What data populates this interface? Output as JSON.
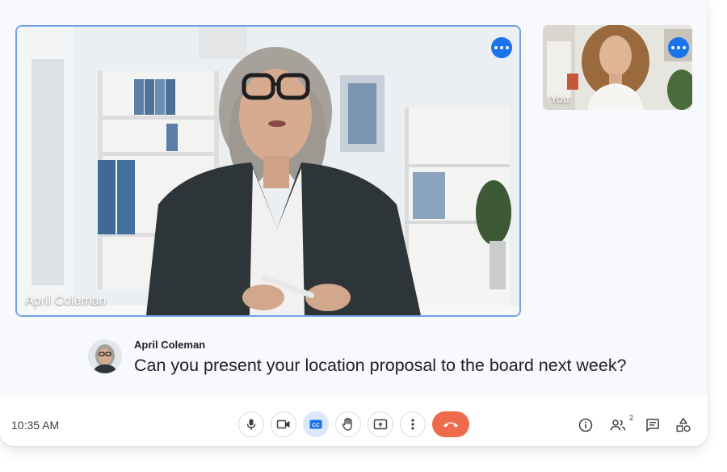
{
  "main_video": {
    "participant_name": "April Coleman"
  },
  "self_video": {
    "label": "You"
  },
  "caption": {
    "speaker": "April Coleman",
    "text": "Can you present your location proposal to the board next week?"
  },
  "toolbar": {
    "time": "10:35 AM",
    "controls": [
      {
        "icon": "microphone-icon",
        "active": false
      },
      {
        "icon": "camera-icon",
        "active": false
      },
      {
        "icon": "closed-captions-icon",
        "active": true
      },
      {
        "icon": "raise-hand-icon",
        "active": false
      },
      {
        "icon": "present-screen-icon",
        "active": false
      },
      {
        "icon": "more-options-icon",
        "active": false
      },
      {
        "icon": "end-call-icon",
        "active": false
      }
    ],
    "right_icons": [
      "meeting-info-icon",
      "people-icon",
      "chat-icon",
      "activities-icon"
    ],
    "people_count": "2"
  },
  "colors": {
    "accent": "#1a73e8",
    "active_tile_border": "#6fa2e8",
    "end_call": "#ee6c4d",
    "captions_active_bg": "#dbe7fc"
  }
}
